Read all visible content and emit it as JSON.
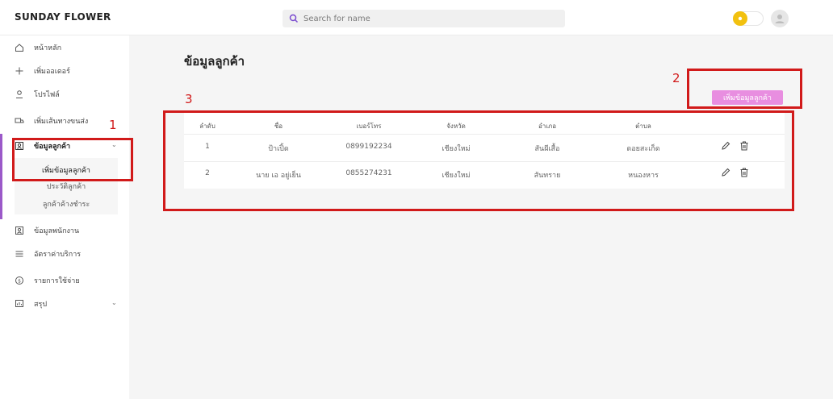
{
  "header": {
    "brand": "SUNDAY FLOWER",
    "search_placeholder": "Search for name"
  },
  "sidebar": {
    "items": [
      {
        "label": "หน้าหลัก",
        "icon": "home-icon"
      },
      {
        "label": "เพิ่มออเดอร์",
        "icon": "plus-icon"
      },
      {
        "label": "โปรไฟล์",
        "icon": "user-icon"
      },
      {
        "label": "เพิ่มเส้นทางขนส่ง",
        "icon": "truck-icon"
      },
      {
        "label": "ข้อมูลลูกค้า",
        "icon": "customers-icon"
      },
      {
        "label": "ข้อมูลพนักงาน",
        "icon": "staff-icon"
      },
      {
        "label": "อัตราค่าบริการ",
        "icon": "rates-icon"
      },
      {
        "label": "รายการใช้จ่าย",
        "icon": "money-icon"
      },
      {
        "label": "สรุป",
        "icon": "report-icon"
      }
    ],
    "sub_items": [
      "เพิ่มข้อมูลลูกค้า",
      "ประวัติลูกค้า",
      "ลูกค้าค้างชำระ"
    ]
  },
  "main": {
    "title": "ข้อมูลลูกค้า",
    "add_button": "เพิ่มข้อมูลลูกค้า",
    "columns": [
      "ลำดับ",
      "ชื่อ",
      "เบอร์โทร",
      "จังหวัด",
      "อำเภอ",
      "ตำบล"
    ],
    "rows": [
      {
        "no": "1",
        "name": "ป้าเปิ้ด",
        "phone": "0899192234",
        "province": "เชียงใหม่",
        "district": "สันผีเสื้อ",
        "subdistrict": "ดอยสะเก็ด"
      },
      {
        "no": "2",
        "name": "นาย เอ อยู่เย็น",
        "phone": "0855274231",
        "province": "เชียงใหม่",
        "district": "สันทราย",
        "subdistrict": "หนองหาร"
      }
    ]
  },
  "annotations": {
    "n1": "1",
    "n2": "2",
    "n3": "3"
  },
  "colors": {
    "accent": "#9b59c9",
    "button": "#e88ee0",
    "annotation": "#d11a1a",
    "sun": "#f2c10f"
  }
}
